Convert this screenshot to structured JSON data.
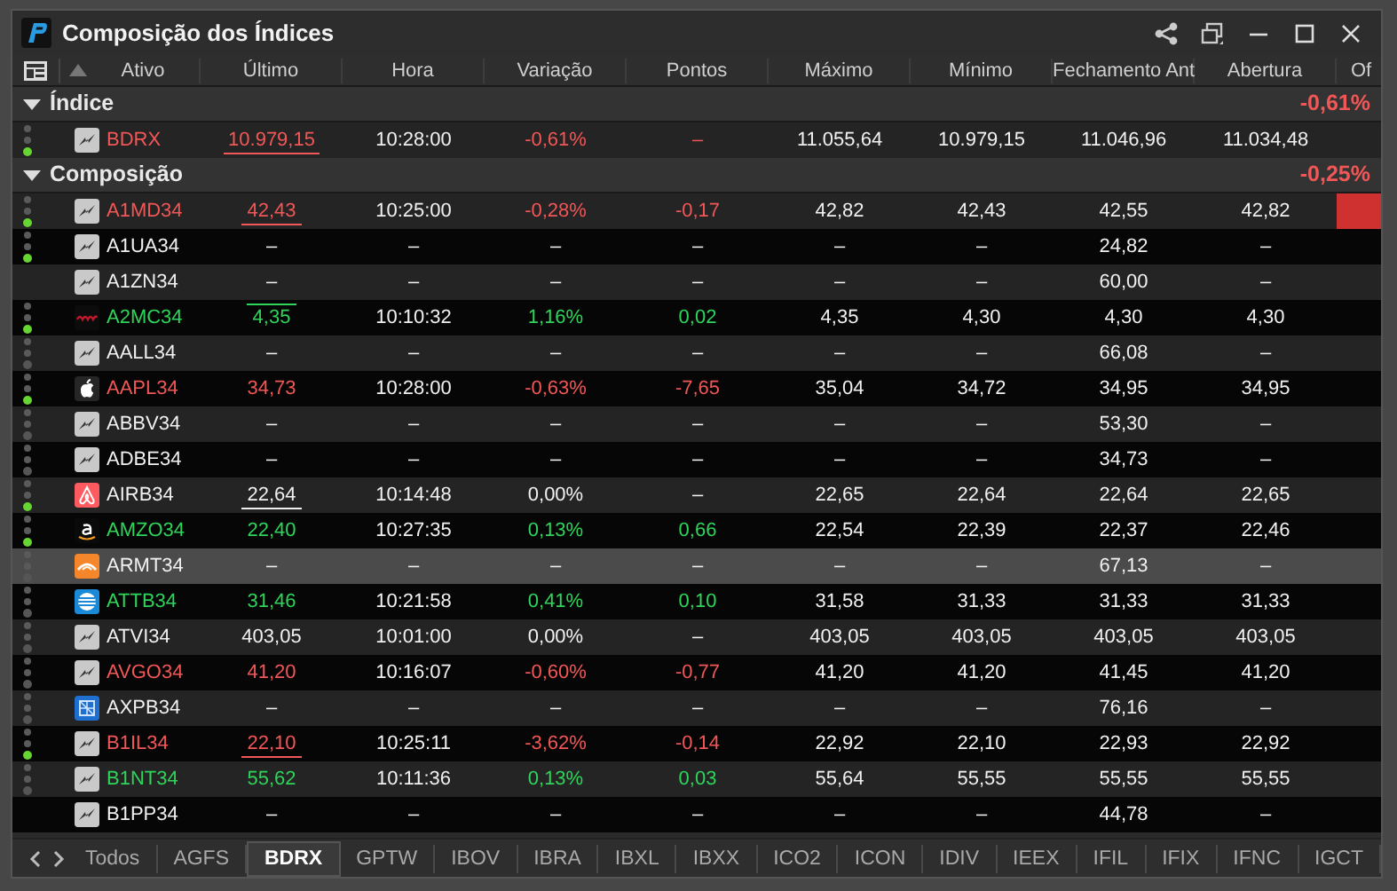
{
  "window": {
    "title": "Composição dos Índices"
  },
  "columns": [
    {
      "label": "Ativo",
      "sorted": true
    },
    {
      "label": "Último"
    },
    {
      "label": "Hora"
    },
    {
      "label": "Variação"
    },
    {
      "label": "Pontos"
    },
    {
      "label": "Máximo"
    },
    {
      "label": "Mínimo"
    },
    {
      "label": "Fechamento Ant"
    },
    {
      "label": "Abertura"
    },
    {
      "label": "Of"
    }
  ],
  "groups": [
    {
      "label": "Índice",
      "expanded": true,
      "change": "-0,61%",
      "color": "#f25757",
      "rows": [
        {
          "ticker": "BDRX",
          "kind": "generic",
          "color": "#f25757",
          "status_shown": true,
          "live": true,
          "selected": false,
          "flash": false,
          "underlined": true,
          "overlined": false,
          "last": "10.979,15",
          "time": "10:28:00",
          "change": "-0,61%",
          "points": "–",
          "high": "11.055,64",
          "low": "10.979,15",
          "prev_close": "11.046,96",
          "open": "11.034,48"
        }
      ]
    },
    {
      "label": "Composição",
      "expanded": true,
      "change": "-0,25%",
      "color": "#f25757",
      "rows": [
        {
          "ticker": "A1MD34",
          "kind": "generic",
          "color": "#f25757",
          "status_shown": true,
          "live": true,
          "selected": false,
          "flash": true,
          "underlined": true,
          "overlined": false,
          "last": "42,43",
          "time": "10:25:00",
          "change": "-0,28%",
          "points": "-0,17",
          "high": "42,82",
          "low": "42,43",
          "prev_close": "42,55",
          "open": "42,82"
        },
        {
          "ticker": "A1UA34",
          "kind": "generic",
          "color": "#f0f0f0",
          "status_shown": true,
          "live": true,
          "selected": false,
          "flash": false,
          "underlined": false,
          "overlined": false,
          "last": "–",
          "time": "–",
          "change": "–",
          "points": "–",
          "high": "–",
          "low": "–",
          "prev_close": "24,82",
          "open": "–"
        },
        {
          "ticker": "A1ZN34",
          "kind": "generic",
          "color": "#f0f0f0",
          "status_shown": false,
          "selected": false,
          "flash": false,
          "underlined": false,
          "overlined": false,
          "last": "–",
          "time": "–",
          "change": "–",
          "points": "–",
          "high": "–",
          "low": "–",
          "prev_close": "60,00",
          "open": "–"
        },
        {
          "ticker": "A2MC34",
          "kind": "amc",
          "color": "#2fd45a",
          "status_shown": true,
          "live": true,
          "selected": false,
          "flash": false,
          "underlined": false,
          "overlined": true,
          "last": "4,35",
          "time": "10:10:32",
          "change": "1,16%",
          "points": "0,02",
          "high": "4,35",
          "low": "4,30",
          "prev_close": "4,30",
          "open": "4,30"
        },
        {
          "ticker": "AALL34",
          "kind": "generic",
          "color": "#f0f0f0",
          "status_shown": true,
          "live": false,
          "selected": false,
          "flash": false,
          "underlined": false,
          "overlined": false,
          "last": "–",
          "time": "–",
          "change": "–",
          "points": "–",
          "high": "–",
          "low": "–",
          "prev_close": "66,08",
          "open": "–"
        },
        {
          "ticker": "AAPL34",
          "kind": "apple",
          "color": "#f25757",
          "status_shown": true,
          "live": true,
          "selected": false,
          "flash": false,
          "underlined": false,
          "overlined": false,
          "last": "34,73",
          "time": "10:28:00",
          "change": "-0,63%",
          "points": "-7,65",
          "high": "35,04",
          "low": "34,72",
          "prev_close": "34,95",
          "open": "34,95"
        },
        {
          "ticker": "ABBV34",
          "kind": "generic",
          "color": "#f0f0f0",
          "status_shown": true,
          "live": false,
          "selected": false,
          "flash": false,
          "underlined": false,
          "overlined": false,
          "last": "–",
          "time": "–",
          "change": "–",
          "points": "–",
          "high": "–",
          "low": "–",
          "prev_close": "53,30",
          "open": "–"
        },
        {
          "ticker": "ADBE34",
          "kind": "generic",
          "color": "#f0f0f0",
          "status_shown": true,
          "live": false,
          "selected": false,
          "flash": false,
          "underlined": false,
          "overlined": false,
          "last": "–",
          "time": "–",
          "change": "–",
          "points": "–",
          "high": "–",
          "low": "–",
          "prev_close": "34,73",
          "open": "–"
        },
        {
          "ticker": "AIRB34",
          "kind": "airbnb",
          "color": "#f0f0f0",
          "status_shown": true,
          "live": true,
          "selected": false,
          "flash": false,
          "underlined": true,
          "overlined": false,
          "last": "22,64",
          "time": "10:14:48",
          "change": "0,00%",
          "points": "–",
          "high": "22,65",
          "low": "22,64",
          "prev_close": "22,64",
          "open": "22,65"
        },
        {
          "ticker": "AMZO34",
          "kind": "amazon",
          "color": "#2fd45a",
          "status_shown": true,
          "live": true,
          "selected": false,
          "flash": false,
          "underlined": false,
          "overlined": false,
          "last": "22,40",
          "time": "10:27:35",
          "change": "0,13%",
          "points": "0,66",
          "high": "22,54",
          "low": "22,39",
          "prev_close": "22,37",
          "open": "22,46"
        },
        {
          "ticker": "ARMT34",
          "kind": "arm",
          "color": "#f0f0f0",
          "status_shown": true,
          "live": false,
          "selected": true,
          "flash": false,
          "underlined": false,
          "overlined": false,
          "last": "–",
          "time": "–",
          "change": "–",
          "points": "–",
          "high": "–",
          "low": "–",
          "prev_close": "67,13",
          "open": "–"
        },
        {
          "ticker": "ATTB34",
          "kind": "att",
          "color": "#2fd45a",
          "status_shown": true,
          "live": false,
          "selected": false,
          "flash": false,
          "underlined": false,
          "overlined": false,
          "last": "31,46",
          "time": "10:21:58",
          "change": "0,41%",
          "points": "0,10",
          "high": "31,58",
          "low": "31,33",
          "prev_close": "31,33",
          "open": "31,33"
        },
        {
          "ticker": "ATVI34",
          "kind": "generic",
          "color": "#f0f0f0",
          "status_shown": true,
          "live": false,
          "selected": false,
          "flash": false,
          "underlined": false,
          "overlined": false,
          "last": "403,05",
          "time": "10:01:00",
          "change": "0,00%",
          "points": "–",
          "high": "403,05",
          "low": "403,05",
          "prev_close": "403,05",
          "open": "403,05"
        },
        {
          "ticker": "AVGO34",
          "kind": "generic",
          "color": "#f25757",
          "status_shown": true,
          "live": false,
          "selected": false,
          "flash": false,
          "underlined": false,
          "overlined": false,
          "last": "41,20",
          "time": "10:16:07",
          "change": "-0,60%",
          "points": "-0,77",
          "high": "41,20",
          "low": "41,20",
          "prev_close": "41,45",
          "open": "41,20"
        },
        {
          "ticker": "AXPB34",
          "kind": "amex",
          "color": "#f0f0f0",
          "status_shown": true,
          "live": false,
          "selected": false,
          "flash": false,
          "underlined": false,
          "overlined": false,
          "last": "–",
          "time": "–",
          "change": "–",
          "points": "–",
          "high": "–",
          "low": "–",
          "prev_close": "76,16",
          "open": "–"
        },
        {
          "ticker": "B1IL34",
          "kind": "generic",
          "color": "#f25757",
          "status_shown": true,
          "live": true,
          "selected": false,
          "flash": false,
          "underlined": true,
          "overlined": false,
          "last": "22,10",
          "time": "10:25:11",
          "change": "-3,62%",
          "points": "-0,14",
          "high": "22,92",
          "low": "22,10",
          "prev_close": "22,93",
          "open": "22,92"
        },
        {
          "ticker": "B1NT34",
          "kind": "generic",
          "color": "#2fd45a",
          "status_shown": true,
          "live": false,
          "selected": false,
          "flash": false,
          "underlined": false,
          "overlined": false,
          "last": "55,62",
          "time": "10:11:36",
          "change": "0,13%",
          "points": "0,03",
          "high": "55,64",
          "low": "55,55",
          "prev_close": "55,55",
          "open": "55,55"
        },
        {
          "ticker": "B1PP34",
          "kind": "generic",
          "color": "#f0f0f0",
          "status_shown": false,
          "selected": false,
          "flash": false,
          "underlined": false,
          "overlined": false,
          "last": "–",
          "time": "–",
          "change": "–",
          "points": "–",
          "high": "–",
          "low": "–",
          "prev_close": "44,78",
          "open": "–"
        }
      ]
    }
  ],
  "tabs": [
    {
      "label": "Todos",
      "selected": false
    },
    {
      "label": "AGFS",
      "selected": false
    },
    {
      "label": "BDRX",
      "selected": true
    },
    {
      "label": "GPTW",
      "selected": false
    },
    {
      "label": "IBOV",
      "selected": false
    },
    {
      "label": "IBRA",
      "selected": false
    },
    {
      "label": "IBXL",
      "selected": false
    },
    {
      "label": "IBXX",
      "selected": false
    },
    {
      "label": "ICO2",
      "selected": false
    },
    {
      "label": "ICON",
      "selected": false
    },
    {
      "label": "IDIV",
      "selected": false
    },
    {
      "label": "IEEX",
      "selected": false
    },
    {
      "label": "IFIL",
      "selected": false
    },
    {
      "label": "IFIX",
      "selected": false
    },
    {
      "label": "IFNC",
      "selected": false
    },
    {
      "label": "IGCT",
      "selected": false
    }
  ]
}
